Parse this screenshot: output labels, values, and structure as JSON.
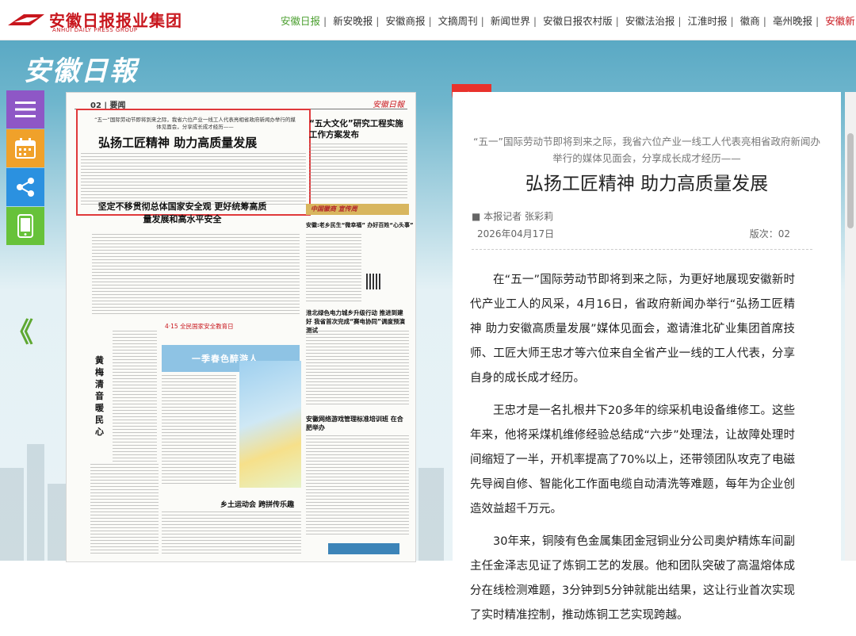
{
  "header": {
    "logo_cn": "安徽日报报业集团",
    "logo_en": "ANHUI DAILY PRESS GROUP",
    "nav": [
      "安徽日报",
      "新安晚报",
      "安徽商报",
      "文摘周刊",
      "新闻世界",
      "安徽日报农村版",
      "安徽法治报",
      "江淮时报",
      "徽商",
      "亳州晚报",
      "安徽新"
    ],
    "accent": "#c8161d",
    "nav_active_color": "#4a9e2e"
  },
  "masthead": "安徽日報",
  "tools": [
    "menu-icon",
    "calendar-icon",
    "share-icon",
    "mobile-icon"
  ],
  "prev_glyph": "《",
  "paper": {
    "page_label": "02 | 要闻",
    "masthead": "安徽日報",
    "subhead": "“五一”国际劳动节即将到来之际，我省六位产业一线工人代表亮相省政府新闻办举行的媒体见面会，分享成长成才经历——",
    "title": "弘扬工匠精神 助力高质量发展",
    "right_title": "“五大文化”研究工程实施工作方案发布",
    "headline2": "坚定不移贯彻总体国家安全观 更好统筹高质量发展和高水平安全",
    "column_tag": "中国徽商 宣传周",
    "headline3": "安徽:老乡民生“微幸福” 办好百姓“心头事”",
    "headline4": "淮北绿色电力城乡升级行动 推进到建好 我省首次完成“赛电协同”调度预演测试",
    "ribbon": "4·15 全民国家安全教育日",
    "spring": "一季春色醉游人",
    "vertical": "黄梅清音暖民心",
    "headline5": "安徽网络游戏管理标准培训班 在合肥举办",
    "headline6": "乡土运动会 跨拼传乐趣"
  },
  "article": {
    "kicker": "“五一”国际劳动节即将到来之际，我省六位产业一线工人代表亮相省政府新闻办举行的媒体见面会，分享成长成才经历——",
    "title": "弘扬工匠精神 助力高质量发展",
    "author": "■ 本报记者 张彩莉",
    "date": "2026年04月17日",
    "version": "版次：02",
    "paragraphs": [
      "在“五一”国际劳动节即将到来之际，为更好地展现安徽新时代产业工人的风采，4月16日，省政府新闻办举行“弘扬工匠精神 助力安徽高质量发展”媒体见面会，邀请淮北矿业集团首席技师、工匠大师王忠才等六位来自全省产业一线的工人代表，分享自身的成长成才经历。",
      "王忠才是一名扎根井下20多年的综采机电设备维修工。这些年来，他将采煤机维修经验总结成“六步”处理法，让故障处理时间缩短了一半，开机率提高了70%以上，还带领团队攻克了电磁先导阀自修、智能化工作面电缆自动清洗等难题，每年为企业创造效益超千万元。",
      "30年来，铜陵有色金属集团金冠铜业分公司奥炉精炼车间副主任金泽志见证了炼铜工艺的发展。他和团队突破了高温熔体成分在线检测难题，3分钟到5分钟就能出结果，这让行业首次实现了实时精准控制，推动炼铜工艺实现跨越。"
    ]
  }
}
